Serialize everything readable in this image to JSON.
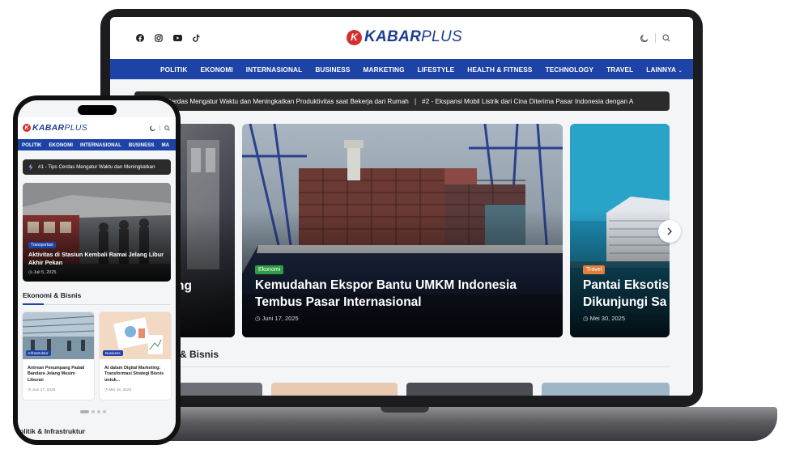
{
  "colors": {
    "brand_blue": "#1e43a7",
    "logo_red": "#d32f2f",
    "ticker_bg": "#2b2b2b",
    "badge_green": "#2e9e44",
    "badge_orange": "#e0803a"
  },
  "logo": {
    "prefix": "KABAR",
    "suffix": "PLUS",
    "mark_letter": "K"
  },
  "laptop": {
    "social_icons": [
      "facebook-icon",
      "instagram-icon",
      "youtube-icon",
      "tiktok-icon"
    ],
    "tool_icons": [
      "moon-icon",
      "search-icon"
    ],
    "nav": [
      "POLITIK",
      "EKONOMI",
      "INTERNASIONAL",
      "BUSINESS",
      "MARKETING",
      "LIFESTYLE",
      "HEALTH & FITNESS",
      "TECHNOLOGY",
      "TRAVEL",
      "LAINNYA"
    ],
    "ticker": [
      "#1 - Tips Cerdas Mengatur Waktu dan Meningkatkan Produktivitas saat Bekerja dari Rumah",
      "#2 - Ekspansi Mobil Listrik dari Cina Diterima Pasar Indonesia dengan A"
    ],
    "slides": [
      {
        "headline_fragment": "ng"
      },
      {
        "category": "Ekonomi",
        "headline": "Kemudahan Ekspor Bantu UMKM Indonesia Tembus Pasar Internasional",
        "date": "Juni 17, 2025"
      },
      {
        "category": "Travel",
        "headline": "Pantai Eksotis Dikunjungi Sa",
        "date": "Mei 30, 2025"
      }
    ],
    "section_title_fragment": "& Bisnis"
  },
  "phone": {
    "nav": [
      "POLITIK",
      "EKONOMI",
      "INTERNASIONAL",
      "BUSINESS",
      "MA"
    ],
    "ticker": "#1 - Tips Cerdas Mengatur Waktu dan Meningkatkan",
    "hero": {
      "category": "Transportasi",
      "title": "Aktivitas di Stasiun Kembali Ramai Jelang Libur Akhir Pekan",
      "date": "Juli 5, 2025"
    },
    "section1": "Ekonomi & Bisnis",
    "cards": [
      {
        "category": "Infrastruktur",
        "title": "Antrean Penumpang Padati Bandara Jelang Musim Liburan",
        "date": "Juni 17, 2025"
      },
      {
        "category": "Business",
        "title": "AI dalam Digital Marketing: Transformasi Strategi Bisnis untuk...",
        "date": "Mei 19, 2025"
      }
    ],
    "section2_fragment": "olitik & Infrastruktur"
  }
}
